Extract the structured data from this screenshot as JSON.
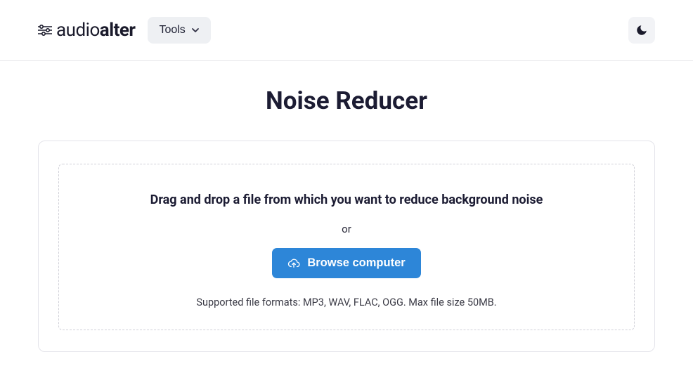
{
  "brand": {
    "prefix": "audio",
    "suffix": "alter"
  },
  "nav": {
    "tools_label": "Tools"
  },
  "page": {
    "title": "Noise Reducer",
    "drop_instruction": "Drag and drop a file from which you want to reduce background noise",
    "or": "or",
    "browse_label": "Browse computer",
    "formats": "Supported file formats: MP3, WAV, FLAC, OGG. Max file size 50MB."
  }
}
